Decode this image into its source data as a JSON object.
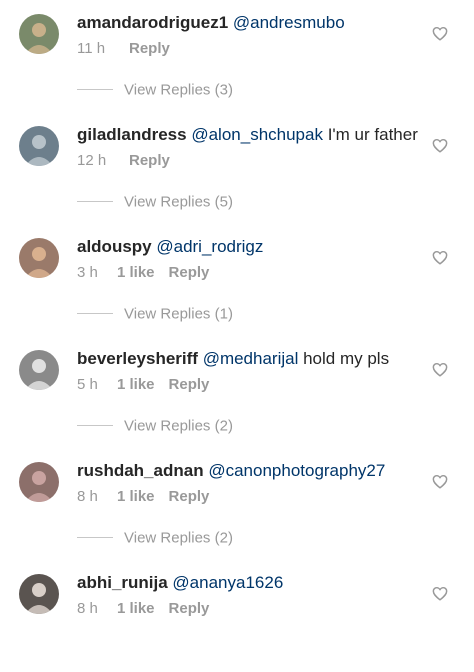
{
  "comments": [
    {
      "username": "amandarodriguez1",
      "mention": "@andresmubo",
      "text": "",
      "time": "11 h",
      "likes": "",
      "reply": "Reply",
      "view_replies": "View Replies (3)",
      "avatar_color": "#7a8a6a",
      "icon": "heart-outline-icon"
    },
    {
      "username": "giladlandress",
      "mention": "@alon_shchupak",
      "text": " I'm ur father",
      "time": "12 h",
      "likes": "",
      "reply": "Reply",
      "view_replies": "View Replies (5)",
      "avatar_color": "#6d7f8c",
      "icon": "heart-outline-icon"
    },
    {
      "username": "aldouspy",
      "mention": "@adri_rodrigz",
      "text": "",
      "time": "3 h",
      "likes": "1 like",
      "reply": "Reply",
      "view_replies": "View Replies (1)",
      "avatar_color": "#9a7a6a",
      "icon": "heart-outline-icon"
    },
    {
      "username": "beverleysheriff",
      "mention": "@medharijal",
      "text": " hold my pls",
      "time": "5 h",
      "likes": "1 like",
      "reply": "Reply",
      "view_replies": "View Replies (2)",
      "avatar_color": "#8a8a8a",
      "icon": "heart-outline-icon"
    },
    {
      "username": "rushdah_adnan",
      "mention": "@canonphotography27",
      "text": "",
      "time": "8 h",
      "likes": "1 like",
      "reply": "Reply",
      "view_replies": "View Replies (2)",
      "avatar_color": "#8c6f6a",
      "icon": "heart-outline-icon"
    },
    {
      "username": "abhi_runija",
      "mention": "@ananya1626",
      "text": "",
      "time": "8 h",
      "likes": "1 like",
      "reply": "Reply",
      "view_replies": "",
      "avatar_color": "#5a5450",
      "icon": "heart-outline-icon"
    }
  ],
  "colors": {
    "username": "#262626",
    "mention": "#003569",
    "meta": "#999999",
    "divider": "#c7c7c7",
    "heart": "#999999"
  }
}
